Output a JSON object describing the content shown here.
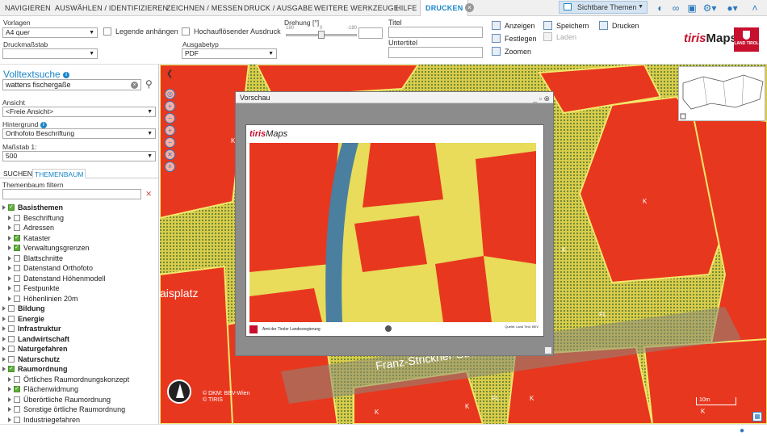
{
  "menu": {
    "items": [
      "NAVIGIEREN",
      "AUSWÄHLEN / IDENTIFIZIEREN",
      "ZEICHNEN / MESSEN",
      "DRUCK / AUSGABE",
      "WEITERE WERKZEUGE",
      "HILFE",
      "DRUCKEN"
    ],
    "active": "DRUCKEN",
    "themes_label": "Sichtbare Themen"
  },
  "ribbon": {
    "vorlagen_label": "Vorlagen",
    "vorlagen_value": "A4 quer",
    "druckmassstab_label": "Druckmaßstab",
    "legende_label": "Legende anhängen",
    "hochaufloesend_label": "Hochauflösender Ausdruck",
    "drehung_label": "Drehung [°]",
    "drehung_ticks": [
      "180",
      "0",
      "-180"
    ],
    "ausgabetyp_label": "Ausgabetyp",
    "ausgabetyp_value": "PDF",
    "titel_label": "Titel",
    "untertitel_label": "Untertitel",
    "anzeigen": "Anzeigen",
    "festlegen": "Festlegen",
    "zoomen": "Zoomen",
    "speichern": "Speichern",
    "laden": "Laden",
    "drucken": "Drucken"
  },
  "brand": {
    "tiris": "tiris",
    "maps": "Maps",
    "land": "LAND TIROL"
  },
  "sidebar": {
    "fts_title": "Volltextsuche",
    "search_value": "wattens fischergaße",
    "ansicht_label": "Ansicht",
    "ansicht_value": "<Freie Ansicht>",
    "hintergrund_label": "Hintergrund",
    "hintergrund_value": "Orthofoto Beschriftung",
    "massstab_label": "Maßstab 1:",
    "massstab_value": "500",
    "tab_suchen": "SUCHEN",
    "tab_themenbaum": "THEMENBAUM",
    "filter_label": "Themenbaum filtern",
    "tree": [
      {
        "label": "Basisthemen",
        "level": 0,
        "checked": true,
        "bold": true
      },
      {
        "label": "Beschriftung",
        "level": 1,
        "checked": false
      },
      {
        "label": "Adressen",
        "level": 1,
        "checked": false
      },
      {
        "label": "Kataster",
        "level": 1,
        "checked": true
      },
      {
        "label": "Verwaltungsgrenzen",
        "level": 1,
        "checked": true
      },
      {
        "label": "Blattschnitte",
        "level": 1,
        "checked": false
      },
      {
        "label": "Datenstand Orthofoto",
        "level": 1,
        "checked": false
      },
      {
        "label": "Datenstand Höhenmodell",
        "level": 1,
        "checked": false
      },
      {
        "label": "Festpunkte",
        "level": 1,
        "checked": false
      },
      {
        "label": "Höhenlinien 20m",
        "level": 1,
        "checked": false
      },
      {
        "label": "Bildung",
        "level": 0,
        "checked": false,
        "bold": true
      },
      {
        "label": "Energie",
        "level": 0,
        "checked": false,
        "bold": true
      },
      {
        "label": "Infrastruktur",
        "level": 0,
        "checked": false,
        "bold": true
      },
      {
        "label": "Landwirtschaft",
        "level": 0,
        "checked": false,
        "bold": true
      },
      {
        "label": "Naturgefahren",
        "level": 0,
        "checked": false,
        "bold": true
      },
      {
        "label": "Naturschutz",
        "level": 0,
        "checked": false,
        "bold": true
      },
      {
        "label": "Raumordnung",
        "level": 0,
        "checked": true,
        "bold": true
      },
      {
        "label": "Örtliches Raumordnungskonzept",
        "level": 1,
        "checked": false
      },
      {
        "label": "Flächenwidmung",
        "level": 1,
        "checked": true
      },
      {
        "label": "Überörtliche Raumordnung",
        "level": 1,
        "checked": false
      },
      {
        "label": "Sonstige örtliche Raumordnung",
        "level": 1,
        "checked": false
      },
      {
        "label": "Industriegefahren",
        "level": 1,
        "checked": false
      }
    ]
  },
  "preview": {
    "title": "Vorschau",
    "sheet_footer_left": "Amt der Tiroler Landesregierung",
    "sheet_footer_right": "Quelle: Land Tirol, BEV"
  },
  "map": {
    "labels": [
      "K",
      "K",
      "K",
      "FL",
      "FL",
      "K",
      "K",
      "K",
      "K"
    ],
    "street": "Franz-Strickner-Straße",
    "place": "aisplatz",
    "copyright": "© DKM: BEV-Wien\n© TIRIS",
    "scale": "10m"
  },
  "colors": {
    "accent": "#1a86c8",
    "zoning_red": "#e8371f",
    "zoning_yellow": "#e8dc5a",
    "tirol_red": "#c8102e"
  }
}
